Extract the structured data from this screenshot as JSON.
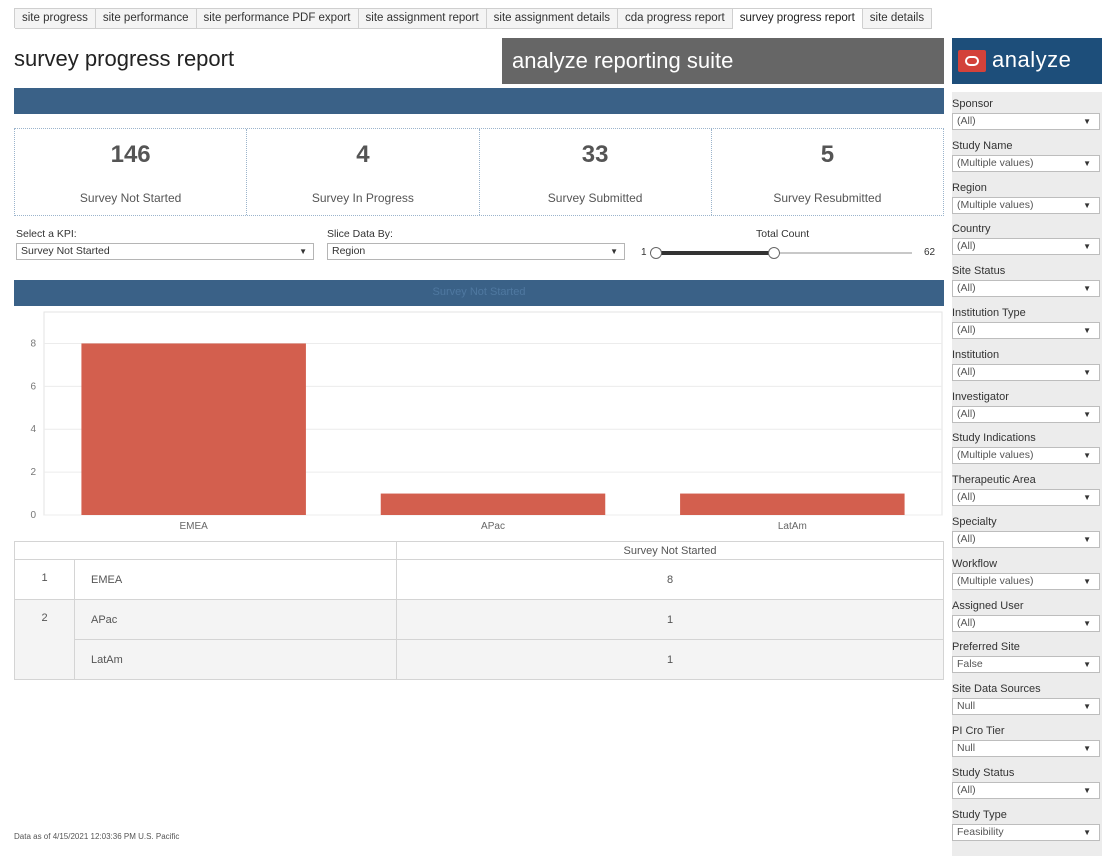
{
  "tabs": [
    {
      "label": "site progress",
      "active": false
    },
    {
      "label": "site performance",
      "active": false
    },
    {
      "label": "site performance PDF export",
      "active": false
    },
    {
      "label": "site assignment report",
      "active": false
    },
    {
      "label": "site assignment details",
      "active": false
    },
    {
      "label": "cda progress report",
      "active": false
    },
    {
      "label": "survey progress report",
      "active": true
    },
    {
      "label": "site details",
      "active": false
    }
  ],
  "header": {
    "title": "survey progress report",
    "suite_title": "analyze reporting suite",
    "logo_text": "analyze"
  },
  "kpis": [
    {
      "value": "146",
      "label": "Survey Not Started"
    },
    {
      "value": "4",
      "label": "Survey In Progress"
    },
    {
      "value": "33",
      "label": "Survey Submitted"
    },
    {
      "value": "5",
      "label": "Survey Resubmitted"
    }
  ],
  "controls": {
    "kpi_label": "Select a KPI:",
    "kpi_value": "Survey Not Started",
    "slice_label": "Slice Data By:",
    "slice_value": "Region",
    "count_label": "Total Count",
    "count_min": "1",
    "count_max": "62",
    "count_selected_fraction": 0.46
  },
  "chart_band_title": "Survey Not Started",
  "chart_data": {
    "type": "bar",
    "categories": [
      "EMEA",
      "APac",
      "LatAm"
    ],
    "values": [
      8,
      1,
      1
    ],
    "yticks": [
      0,
      2,
      4,
      6,
      8
    ],
    "ylim": [
      0,
      9
    ],
    "grid": true,
    "bar_color": "#d35f4e"
  },
  "table": {
    "header": "Survey Not Started",
    "rows": [
      {
        "num": "1",
        "name": "EMEA",
        "value": "8"
      },
      {
        "num": "2",
        "name": "APac",
        "value": "1"
      },
      {
        "num": "",
        "name": "LatAm",
        "value": "1"
      }
    ]
  },
  "data_as_of": "Data as of 4/15/2021 12:03:36 PM U.S. Pacific",
  "filters": [
    {
      "label": "Sponsor",
      "value": "(All)"
    },
    {
      "label": "Study Name",
      "value": "(Multiple values)"
    },
    {
      "label": "Region",
      "value": "(Multiple values)"
    },
    {
      "label": "Country",
      "value": "(All)"
    },
    {
      "label": "Site Status",
      "value": "(All)"
    },
    {
      "label": "Institution Type",
      "value": "(All)"
    },
    {
      "label": "Institution",
      "value": "(All)"
    },
    {
      "label": "Investigator",
      "value": "(All)"
    },
    {
      "label": "Study Indications",
      "value": "(Multiple values)"
    },
    {
      "label": "Therapeutic Area",
      "value": "(All)"
    },
    {
      "label": "Specialty",
      "value": "(All)"
    },
    {
      "label": "Workflow",
      "value": "(Multiple values)"
    },
    {
      "label": "Assigned User",
      "value": "(All)"
    },
    {
      "label": "Preferred Site",
      "value": "False"
    },
    {
      "label": "Site Data Sources",
      "value": "Null"
    },
    {
      "label": "PI Cro Tier",
      "value": "Null"
    },
    {
      "label": "Study Status",
      "value": "(All)"
    },
    {
      "label": "Study Type",
      "value": "Feasibility"
    }
  ],
  "icons": {
    "dropdown": "chevron-down-icon",
    "logo": "analyze-logo-icon"
  }
}
